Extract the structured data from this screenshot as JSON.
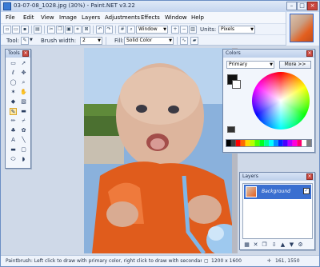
{
  "window": {
    "title": "03-07-08_1028.jpg (30%) - Paint.NET v3.22",
    "min_glyph": "–",
    "max_glyph": "□",
    "close_glyph": "×"
  },
  "menu": [
    "File",
    "Edit",
    "View",
    "Image",
    "Layers",
    "Adjustments",
    "Effects",
    "Window",
    "Help"
  ],
  "toolbar": {
    "zoom_value": "Window",
    "units_label": "Units:",
    "units_value": "Pixels",
    "tool_label": "Tool:",
    "brush_width_label": "Brush width:",
    "brush_width_value": "2",
    "fill_label": "Fill:",
    "fill_value": "Solid Color"
  },
  "tools_panel": {
    "title": "Tools"
  },
  "colors_panel": {
    "title": "Colors",
    "mode_value": "Primary",
    "more_button": "More >>"
  },
  "layers_panel": {
    "title": "Layers",
    "layer_name": "Background"
  },
  "status": {
    "hint": "Paintbrush: Left click to draw with primary color, right click to draw with secondary color.",
    "size": "1200 x 1600",
    "coords": "161, 1550"
  },
  "colors": {
    "palette": [
      "#000000",
      "#404040",
      "#ff0000",
      "#ff6a00",
      "#ffd800",
      "#b6ff00",
      "#4cff00",
      "#00ff21",
      "#00ff90",
      "#00ffff",
      "#0094ff",
      "#0026ff",
      "#4800ff",
      "#b200ff",
      "#ff00dc",
      "#ff006e",
      "#ffffff",
      "#808080"
    ]
  }
}
